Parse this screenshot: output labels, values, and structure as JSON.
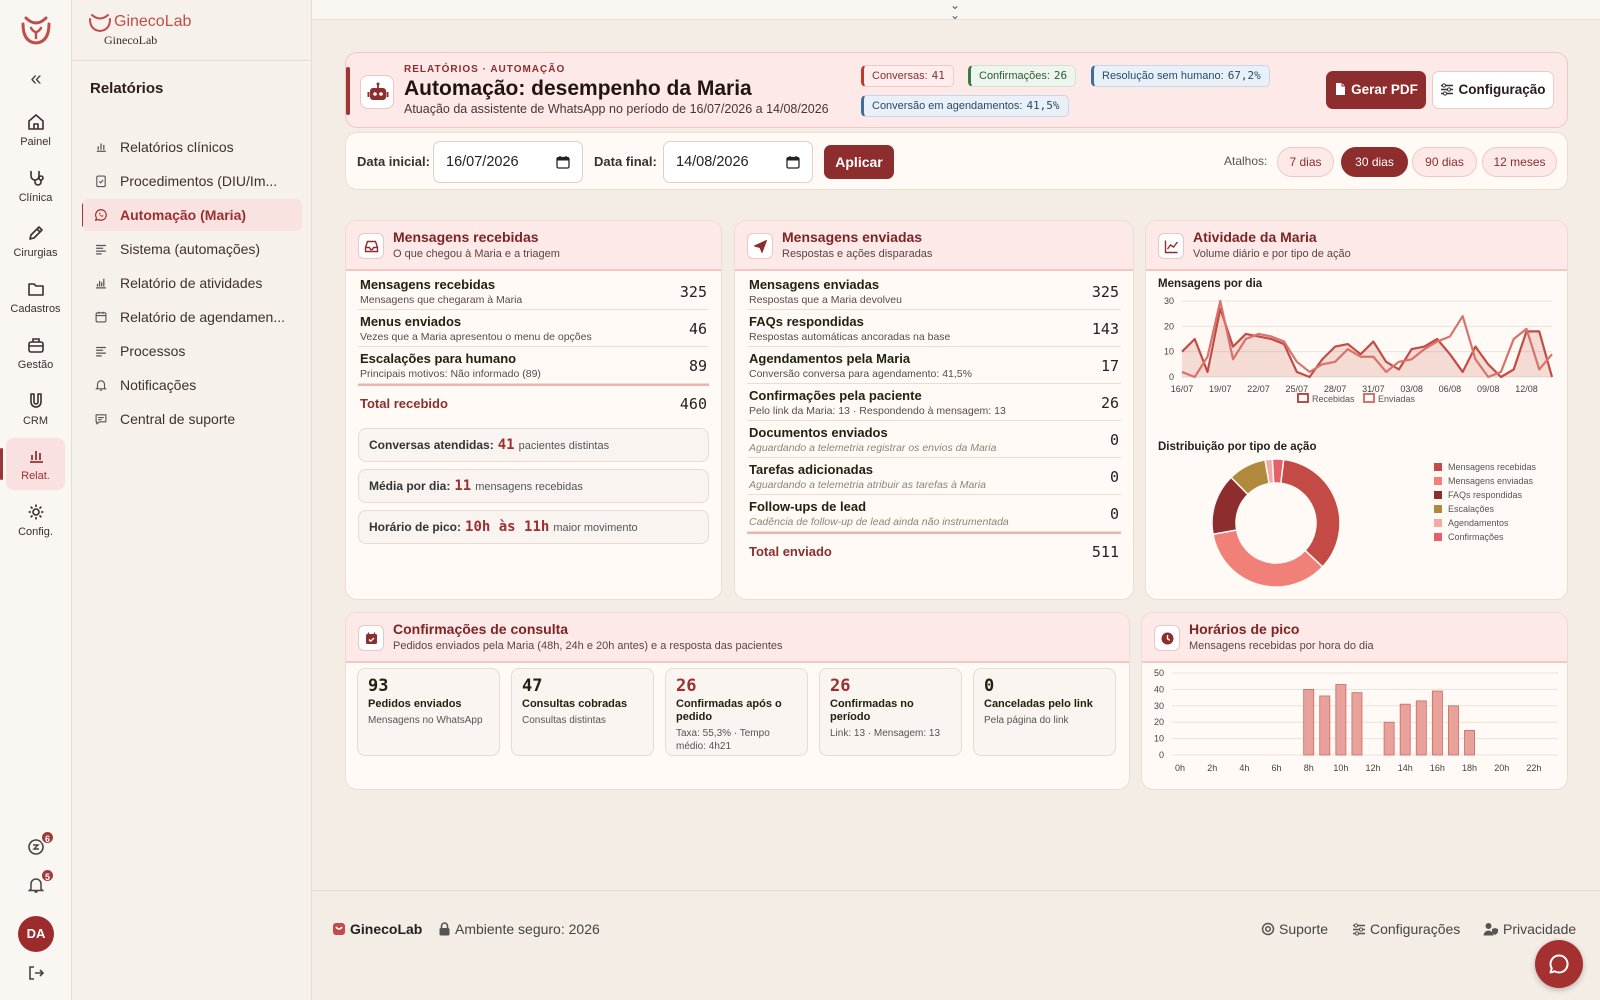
{
  "app": {
    "brand_name": "GinecoLab",
    "brand_sub": "GinecoLab"
  },
  "rail": {
    "items": [
      {
        "label": "Painel",
        "icon": "home-icon"
      },
      {
        "label": "Clínica",
        "icon": "stethoscope-icon"
      },
      {
        "label": "Cirurgias",
        "icon": "pen-icon"
      },
      {
        "label": "Cadastros",
        "icon": "folder-icon"
      },
      {
        "label": "Gestão",
        "icon": "briefcase-icon"
      },
      {
        "label": "CRM",
        "icon": "magnet-icon"
      },
      {
        "label": "Relat.",
        "icon": "bar-chart-icon",
        "active": true
      },
      {
        "label": "Config.",
        "icon": "gear-icon"
      }
    ],
    "billing_badge": "6",
    "notif_badge": "5",
    "avatar": "DA"
  },
  "sidebar": {
    "title": "Relatórios",
    "items": [
      {
        "label": "Relatórios clínicos",
        "icon": "bar-chart-icon"
      },
      {
        "label": "Procedimentos (DIU/Im...",
        "icon": "clipboard-icon"
      },
      {
        "label": "Automação (Maria)",
        "icon": "whatsapp-icon",
        "active": true
      },
      {
        "label": "Sistema (automações)",
        "icon": "list-icon"
      },
      {
        "label": "Relatório de atividades",
        "icon": "activity-chart-icon"
      },
      {
        "label": "Relatório de agendamen...",
        "icon": "calendar-icon"
      },
      {
        "label": "Processos",
        "icon": "list-icon"
      },
      {
        "label": "Notificações",
        "icon": "bell-icon"
      },
      {
        "label": "Central de suporte",
        "icon": "message-icon"
      }
    ]
  },
  "header": {
    "eyebrow": "RELATÓRIOS · AUTOMAÇÃO",
    "title": "Automação: desempenho da Maria",
    "subtitle": "Atuação da assistente de WhatsApp no período de 16/07/2026 a 14/08/2026",
    "pills": [
      {
        "label": "Conversas:",
        "value": "41",
        "tone": "red"
      },
      {
        "label": "Confirmações:",
        "value": "26",
        "tone": "green"
      },
      {
        "label": "Resolução sem humano:",
        "value": "67,2%",
        "tone": "blue"
      },
      {
        "label": "Conversão em agendamentos:",
        "value": "41,5%",
        "tone": "blue"
      }
    ],
    "pdf_button": "Gerar PDF",
    "config_button": "Configuração"
  },
  "filters": {
    "start_label": "Data inicial:",
    "start_value": "16/07/2026",
    "end_label": "Data final:",
    "end_value": "14/08/2026",
    "apply_button": "Aplicar",
    "shortcuts_label": "Atalhos:",
    "shortcuts": [
      "7 dias",
      "30 dias",
      "90 dias",
      "12 meses"
    ],
    "active_shortcut": "30 dias"
  },
  "received": {
    "title": "Mensagens recebidas",
    "subtitle": "O que chegou à Maria e a triagem",
    "rows": [
      {
        "label": "Mensagens recebidas",
        "sub": "Mensagens que chegaram à Maria",
        "value": "325"
      },
      {
        "label": "Menus enviados",
        "sub": "Vezes que a Maria apresentou o menu de opções",
        "value": "46"
      },
      {
        "label": "Escalações para humano",
        "sub": "Principais motivos: Não informado (89)",
        "value": "89"
      }
    ],
    "total_label": "Total recebido",
    "total_value": "460",
    "stats": [
      {
        "label": "Conversas atendidas:",
        "value": "41",
        "suffix": "pacientes distintas"
      },
      {
        "label": "Média por dia:",
        "value": "11",
        "suffix": "mensagens recebidas"
      },
      {
        "label": "Horário de pico:",
        "value": "10h às 11h",
        "suffix": "maior movimento"
      }
    ]
  },
  "sent": {
    "title": "Mensagens enviadas",
    "subtitle": "Respostas e ações disparadas",
    "rows": [
      {
        "label": "Mensagens enviadas",
        "sub": "Respostas que a Maria devolveu",
        "value": "325"
      },
      {
        "label": "FAQs respondidas",
        "sub": "Respostas automáticas ancoradas na base",
        "value": "143"
      },
      {
        "label": "Agendamentos pela Maria",
        "sub": "Conversão conversa para agendamento: 41,5%",
        "value": "17"
      },
      {
        "label": "Confirmações pela paciente",
        "sub": "Pelo link da Maria: 13 · Respondendo à mensagem: 13",
        "value": "26"
      },
      {
        "label": "Documentos enviados",
        "sub": "Aguardando a telemetria registrar os envios da Maria",
        "value": "0",
        "muted": true
      },
      {
        "label": "Tarefas adicionadas",
        "sub": "Aguardando a telemetria atribuir as tarefas à Maria",
        "value": "0",
        "muted": true
      },
      {
        "label": "Follow-ups de lead",
        "sub": "Cadência de follow-up de lead ainda não instrumentada",
        "value": "0",
        "muted": true
      }
    ],
    "total_label": "Total enviado",
    "total_value": "511"
  },
  "activity": {
    "title": "Atividade da Maria",
    "subtitle": "Volume diário e por tipo de ação",
    "line_title": "Mensagens por dia",
    "donut_title": "Distribuição por tipo de ação"
  },
  "confirmations": {
    "title": "Confirmações de consulta",
    "subtitle": "Pedidos enviados pela Maria (48h, 24h e 20h antes) e a resposta das pacientes",
    "boxes": [
      {
        "value": "93",
        "label": "Pedidos enviados",
        "sub": "Mensagens no WhatsApp",
        "red": false
      },
      {
        "value": "47",
        "label": "Consultas cobradas",
        "sub": "Consultas distintas",
        "red": false
      },
      {
        "value": "26",
        "label": "Confirmadas após o pedido",
        "sub": "Taxa: 55,3% · Tempo médio: 4h21",
        "red": true
      },
      {
        "value": "26",
        "label": "Confirmadas no período",
        "sub": "Link: 13 · Mensagem: 13",
        "red": true
      },
      {
        "value": "0",
        "label": "Canceladas pelo link",
        "sub": "Pela página do link",
        "red": false
      }
    ]
  },
  "peak": {
    "title": "Horários de pico",
    "subtitle": "Mensagens recebidas por hora do dia"
  },
  "footer": {
    "brand": "GinecoLab",
    "secure": "Ambiente seguro: 2026",
    "links": [
      "Suporte",
      "Configurações",
      "Privacidade"
    ]
  },
  "colors": {
    "primary": "#8e2d2d",
    "accent": "#c24c4c",
    "soft": "#fde9e7"
  },
  "chart_data": [
    {
      "type": "line",
      "title": "Mensagens por dia",
      "x": [
        "16/07",
        "17/07",
        "18/07",
        "19/07",
        "20/07",
        "21/07",
        "22/07",
        "23/07",
        "24/07",
        "25/07",
        "26/07",
        "27/07",
        "28/07",
        "29/07",
        "30/07",
        "31/07",
        "01/08",
        "02/08",
        "03/08",
        "04/08",
        "05/08",
        "06/08",
        "07/08",
        "08/08",
        "09/08",
        "10/08",
        "11/08",
        "12/08",
        "13/08",
        "14/08"
      ],
      "xticks": [
        "16/07",
        "19/07",
        "22/07",
        "25/07",
        "28/07",
        "31/07",
        "03/08",
        "06/08",
        "09/08",
        "12/08"
      ],
      "ylim": [
        0,
        30
      ],
      "yticks": [
        0,
        10,
        20,
        30
      ],
      "series": [
        {
          "name": "Recebidas",
          "color": "#c44b45",
          "fill": true,
          "values": [
            10,
            15,
            2,
            27,
            12,
            17,
            16,
            15,
            13,
            2,
            0,
            7,
            12,
            13,
            9,
            14,
            6,
            3,
            11,
            12,
            15,
            9,
            2,
            12,
            5,
            0,
            3,
            18,
            18,
            0
          ]
        },
        {
          "name": "Enviadas",
          "color": "#d8736c",
          "fill": false,
          "values": [
            2,
            0,
            8,
            30,
            7,
            15,
            17,
            16,
            14,
            6,
            2,
            5,
            6,
            11,
            8,
            8,
            2,
            6,
            7,
            11,
            14,
            16,
            24,
            7,
            0,
            2,
            15,
            19,
            3,
            9
          ]
        }
      ],
      "legend": "bottom"
    },
    {
      "type": "pie",
      "title": "Distribuição por tipo de ação",
      "donut": true,
      "labels": [
        "Mensagens recebidas",
        "Mensagens enviadas",
        "FAQs respondidas",
        "Escalações",
        "Agendamentos",
        "Confirmações"
      ],
      "values": [
        325,
        325,
        143,
        89,
        17,
        26
      ],
      "colors": [
        "#c44b45",
        "#f08078",
        "#8e2d2d",
        "#b0893c",
        "#f2aaa6",
        "#e4606a"
      ],
      "legend": "right"
    },
    {
      "type": "bar",
      "title": "Horários de pico",
      "categories": [
        "0h",
        "1h",
        "2h",
        "3h",
        "4h",
        "5h",
        "6h",
        "7h",
        "8h",
        "9h",
        "10h",
        "11h",
        "12h",
        "13h",
        "14h",
        "15h",
        "16h",
        "17h",
        "18h",
        "19h",
        "20h",
        "21h",
        "22h",
        "23h"
      ],
      "xticks": [
        "0h",
        "2h",
        "4h",
        "6h",
        "8h",
        "10h",
        "12h",
        "14h",
        "16h",
        "18h",
        "20h",
        "22h"
      ],
      "values": [
        0,
        0,
        0,
        0,
        0,
        0,
        0,
        0,
        40,
        36,
        43,
        38,
        0,
        20,
        31,
        33,
        39,
        30,
        15,
        0,
        0,
        0,
        0,
        0
      ],
      "ylim": [
        0,
        50
      ],
      "yticks": [
        0,
        10,
        20,
        30,
        40,
        50
      ],
      "color": "#e8a19b"
    }
  ]
}
